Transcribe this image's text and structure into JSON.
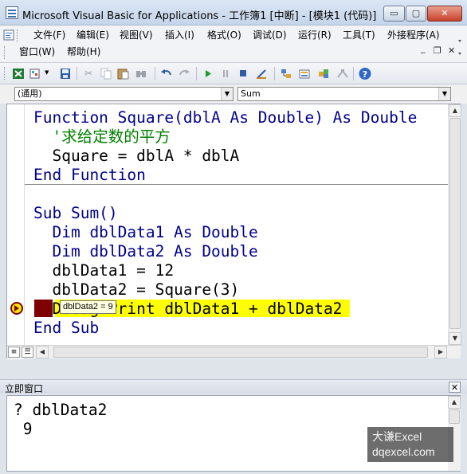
{
  "window": {
    "title": "Microsoft Visual Basic for Applications - 工作簿1 [中断] - [模块1 (代码)]",
    "controls": {
      "minimize": "▭",
      "maximize": "▢",
      "close": "✕"
    }
  },
  "menu": {
    "items": [
      "文件(F)",
      "编辑(E)",
      "视图(V)",
      "插入(I)",
      "格式(O)",
      "调试(D)",
      "运行(R)",
      "工具(T)",
      "外接程序(A)",
      "窗口(W)",
      "帮助(H)"
    ],
    "mdi_controls": {
      "minimize": "_",
      "restore": "❐",
      "close": "✕"
    }
  },
  "toolbar": {
    "icons": [
      "excel-icon",
      "insert-userform-icon",
      "save-icon",
      "cut-icon",
      "copy-icon",
      "paste-icon",
      "find-icon",
      "undo-icon",
      "redo-icon",
      "run-icon",
      "break-icon",
      "reset-icon",
      "design-mode-icon",
      "project-explorer-icon",
      "properties-icon",
      "object-browser-icon",
      "toolbox-icon",
      "help-icon"
    ]
  },
  "combos": {
    "object": "(通用)",
    "procedure": "Sum"
  },
  "code": {
    "lines": [
      [
        {
          "t": "Function Square(dblA As Double) As Double",
          "c": "kw"
        }
      ],
      [
        {
          "t": "  '求给定数的平方",
          "c": "cm"
        }
      ],
      [
        {
          "t": "  Square = dblA * dblA",
          "c": ""
        }
      ],
      [
        {
          "t": "End Function",
          "c": "kw"
        }
      ],
      [
        {
          "t": "",
          "c": ""
        }
      ],
      [
        {
          "t": "Sub Sum()",
          "c": "kw"
        }
      ],
      [
        {
          "t": "  Dim dblData1 As Double",
          "c": "kw"
        }
      ],
      [
        {
          "t": "  Dim dblData2 As Double",
          "c": "kw"
        }
      ],
      [
        {
          "t": "  dblData1 = 12",
          "c": ""
        }
      ],
      [
        {
          "t": "  dblData2 = Square(3)",
          "c": ""
        }
      ],
      [
        {
          "t": "  Debug.Print dblData1 + dblData2",
          "c": ""
        }
      ],
      [
        {
          "t": "End Sub",
          "c": "kw"
        }
      ]
    ],
    "tooltip": "dblData2 = 9"
  },
  "immediate": {
    "title": "立即窗口",
    "close": "✕",
    "lines": [
      "? dblData2",
      " 9"
    ]
  },
  "watermark": {
    "line1": "大谦Excel",
    "line2": "dqexcel.com"
  },
  "colors": {
    "keyword": "#00008b",
    "comment": "#008000",
    "execution_highlight": "#ffff00",
    "breakpoint": "#7f0000"
  }
}
